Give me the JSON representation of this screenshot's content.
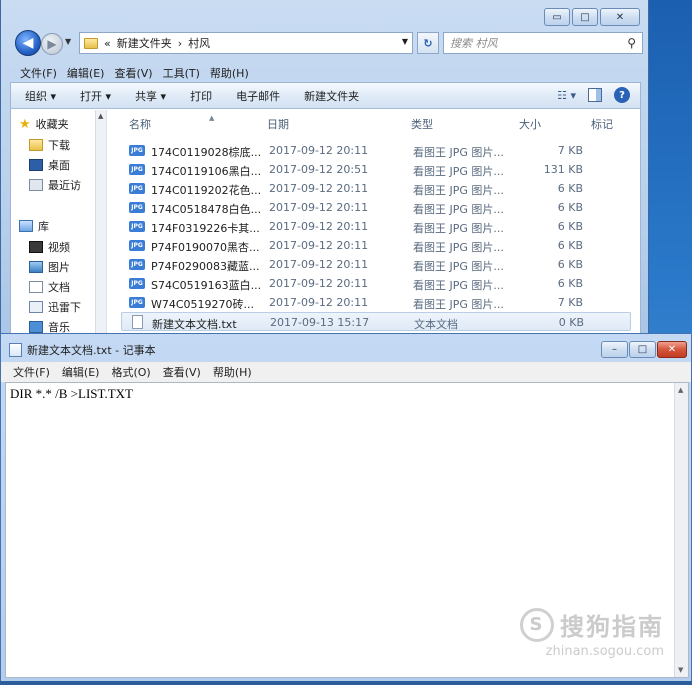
{
  "explorer": {
    "address": {
      "prefix": "«",
      "crumbs": [
        "新建文件夹",
        "村风"
      ],
      "sep": "›"
    },
    "search_placeholder": "搜索 村风",
    "caption": {
      "min": "▭",
      "max": "□",
      "close": "✕"
    },
    "menu": [
      "文件(F)",
      "编辑(E)",
      "查看(V)",
      "工具(T)",
      "帮助(H)"
    ],
    "toolbar": [
      "组织 ▾",
      "打开 ▾",
      "共享 ▾",
      "打印",
      "电子邮件",
      "新建文件夹"
    ],
    "nav": [
      {
        "label": "收藏夹",
        "icon": "star-icon"
      },
      {
        "label": "下载",
        "icon": "download-folder-icon"
      },
      {
        "label": "桌面",
        "icon": "desktop-icon"
      },
      {
        "label": "最近访",
        "icon": "recent-places-icon"
      },
      {
        "label": "库",
        "icon": "library-icon"
      },
      {
        "label": "视频",
        "icon": "video-library-icon"
      },
      {
        "label": "图片",
        "icon": "pictures-library-icon"
      },
      {
        "label": "文档",
        "icon": "documents-library-icon"
      },
      {
        "label": "迅雷下",
        "icon": "thunder-download-icon"
      },
      {
        "label": "音乐",
        "icon": "music-library-icon"
      }
    ],
    "columns": {
      "name": "名称",
      "date": "日期",
      "type": "类型",
      "size": "大小",
      "tags": "标记"
    },
    "files": [
      {
        "name": "174C0119028棕底...",
        "date": "2017-09-12 20:11",
        "type": "看图王 JPG 图片...",
        "size": "7 KB",
        "icon": "jpg"
      },
      {
        "name": "174C0119106黑白...",
        "date": "2017-09-12 20:51",
        "type": "看图王 JPG 图片...",
        "size": "131 KB",
        "icon": "jpg"
      },
      {
        "name": "174C0119202花色...",
        "date": "2017-09-12 20:11",
        "type": "看图王 JPG 图片...",
        "size": "6 KB",
        "icon": "jpg"
      },
      {
        "name": "174C0518478白色...",
        "date": "2017-09-12 20:11",
        "type": "看图王 JPG 图片...",
        "size": "6 KB",
        "icon": "jpg"
      },
      {
        "name": "174F0319226卡其...",
        "date": "2017-09-12 20:11",
        "type": "看图王 JPG 图片...",
        "size": "6 KB",
        "icon": "jpg"
      },
      {
        "name": "P74F0190070黑杏...",
        "date": "2017-09-12 20:11",
        "type": "看图王 JPG 图片...",
        "size": "6 KB",
        "icon": "jpg"
      },
      {
        "name": "P74F0290083藏蓝...",
        "date": "2017-09-12 20:11",
        "type": "看图王 JPG 图片...",
        "size": "6 KB",
        "icon": "jpg"
      },
      {
        "name": "S74C0519163蓝白...",
        "date": "2017-09-12 20:11",
        "type": "看图王 JPG 图片...",
        "size": "6 KB",
        "icon": "jpg"
      },
      {
        "name": "W74C0519270砖...",
        "date": "2017-09-12 20:11",
        "type": "看图王 JPG 图片...",
        "size": "7 KB",
        "icon": "jpg"
      },
      {
        "name": "新建文本文档.txt",
        "date": "2017-09-13 15:17",
        "type": "文本文档",
        "size": "0 KB",
        "icon": "txt",
        "selected": true
      }
    ]
  },
  "notepad": {
    "title": "新建文本文档.txt - 记事本",
    "menu": [
      "文件(F)",
      "编辑(E)",
      "格式(O)",
      "查看(V)",
      "帮助(H)"
    ],
    "content": "DIR *.* /B >LIST.TXT",
    "caption": {
      "min": "–",
      "max": "□",
      "close": "✕"
    }
  },
  "watermark": {
    "main": "搜狗指南",
    "sub": "zhinan.sogou.com"
  }
}
